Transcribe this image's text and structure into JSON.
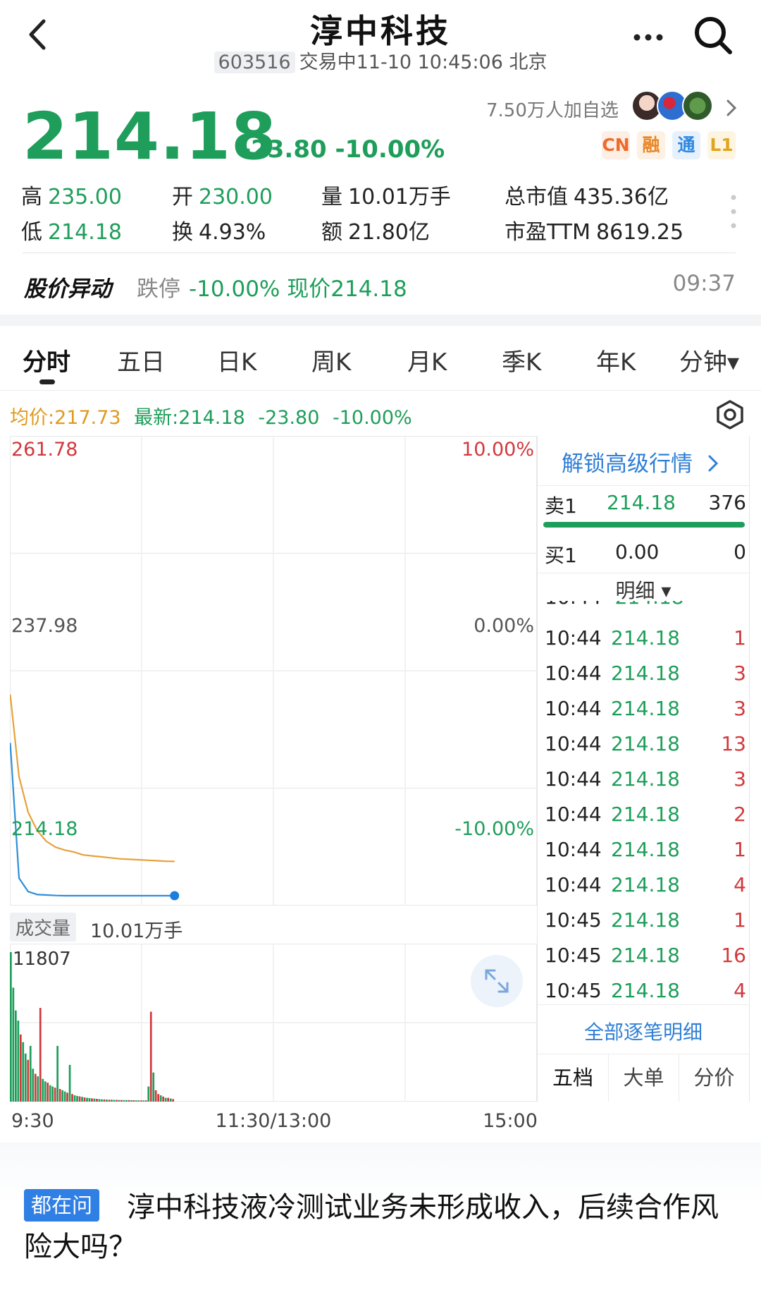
{
  "header": {
    "title": "淳中科技",
    "code": "603516",
    "status": "交易中11-10 10:45:06 北京"
  },
  "quote": {
    "price": "214.18",
    "change": "-23.80 -10.00%",
    "watchers": "7.50万人加自选",
    "tags": [
      {
        "label": "CN",
        "color": "#f06a2a",
        "bg": "#fdeee6"
      },
      {
        "label": "融",
        "color": "#e8872a",
        "bg": "#fdf1e3"
      },
      {
        "label": "通",
        "color": "#2f88e0",
        "bg": "#e6f1fd"
      },
      {
        "label": "L1",
        "color": "#e0a51f",
        "bg": "#fdf5e1"
      }
    ],
    "stats": [
      {
        "label": "高",
        "value": "235.00",
        "color": "green"
      },
      {
        "label": "开",
        "value": "230.00",
        "color": "green"
      },
      {
        "label": "量",
        "value": "10.01万手",
        "color": "plain"
      },
      {
        "label": "总市值",
        "value": "435.36亿",
        "color": "plain"
      },
      {
        "label": "低",
        "value": "214.18",
        "color": "green"
      },
      {
        "label": "换",
        "value": "4.93%",
        "color": "plain"
      },
      {
        "label": "额",
        "value": "21.80亿",
        "color": "plain"
      },
      {
        "label": "市盈TTM",
        "value": "8619.25",
        "color": "plain"
      }
    ]
  },
  "alert": {
    "label": "股价异动",
    "type": "跌停",
    "detail": "-10.00% 现价214.18",
    "time": "09:37"
  },
  "tabs": [
    "分时",
    "五日",
    "日K",
    "周K",
    "月K",
    "季K",
    "年K",
    "分钟▾"
  ],
  "chart_info": {
    "avg": "均价:217.73",
    "latest": "最新:214.18",
    "change": "-23.80",
    "pct": "-10.00%"
  },
  "chart_labels": {
    "y_top": "261.78",
    "y_mid": "237.98",
    "y_bottom": "214.18",
    "pct_top": "10.00%",
    "pct_mid": "0.00%",
    "pct_bottom": "-10.00%",
    "volume_tag": "成交量",
    "volume_total": "10.01万手",
    "volume_max": "11807",
    "x_labels": [
      "9:30",
      "11:30/13:00",
      "15:00"
    ]
  },
  "chart_data": {
    "type": "line",
    "ylim": [
      214.18,
      261.78
    ],
    "prev_close": 237.98,
    "series": [
      {
        "name": "均价",
        "color": "#e6a23c",
        "values": [
          235.0,
          226.5,
          222.8,
          220.9,
          219.8,
          219.2,
          218.9,
          218.7,
          218.4,
          218.3,
          218.2,
          218.1,
          218.0,
          217.95,
          217.9,
          217.85,
          217.8,
          217.75,
          217.73
        ]
      },
      {
        "name": "最新",
        "color": "#2f8ed8",
        "values": [
          230.0,
          216.0,
          214.6,
          214.3,
          214.25,
          214.2,
          214.18,
          214.18,
          214.18,
          214.18,
          214.18,
          214.18,
          214.18,
          214.18,
          214.18,
          214.18,
          214.18,
          214.18,
          214.18
        ]
      }
    ],
    "volume": {
      "max": 11807,
      "bars": [
        11807,
        9000,
        7200,
        6400,
        5300,
        4700,
        3800,
        3300,
        4400,
        2600,
        2200,
        2000,
        7400,
        1800,
        1600,
        1500,
        1300,
        1200,
        1100,
        4400,
        1000,
        900,
        800,
        700,
        2900,
        600,
        500,
        450,
        420,
        380,
        330,
        300,
        280,
        260,
        240,
        220,
        200,
        180,
        170,
        160,
        150,
        150,
        140,
        140,
        130,
        130,
        120,
        120,
        120,
        110,
        110,
        100,
        100,
        100,
        100,
        100,
        1200,
        7100,
        2300,
        900,
        600,
        500,
        400,
        300,
        300,
        250,
        200
      ],
      "colors": [
        "g",
        "g",
        "g",
        "g",
        "r",
        "g",
        "g",
        "r",
        "g",
        "g",
        "r",
        "g",
        "r",
        "g",
        "g",
        "r",
        "g",
        "g",
        "r",
        "g",
        "r",
        "g",
        "g",
        "r",
        "g",
        "r",
        "g",
        "g",
        "r",
        "g",
        "r",
        "g",
        "g",
        "r",
        "g",
        "r",
        "g",
        "g",
        "r",
        "g",
        "r",
        "g",
        "g",
        "r",
        "g",
        "r",
        "g",
        "g",
        "r",
        "g",
        "r",
        "g",
        "g",
        "r",
        "g",
        "r",
        "g",
        "r",
        "g",
        "r",
        "r",
        "g",
        "r",
        "g",
        "r",
        "g",
        "r"
      ]
    }
  },
  "order_book": {
    "unlock": "解锁高级行情",
    "sell1": {
      "label": "卖1",
      "price": "214.18",
      "qty": "376"
    },
    "buy1": {
      "label": "买1",
      "price": "0.00",
      "qty": "0"
    },
    "detail_title": "明细 ▾",
    "ticks": [
      {
        "time": "10:44",
        "price": "214.18",
        "vol": "1"
      },
      {
        "time": "10:44",
        "price": "214.18",
        "vol": "3"
      },
      {
        "time": "10:44",
        "price": "214.18",
        "vol": "3"
      },
      {
        "time": "10:44",
        "price": "214.18",
        "vol": "13"
      },
      {
        "time": "10:44",
        "price": "214.18",
        "vol": "3"
      },
      {
        "time": "10:44",
        "price": "214.18",
        "vol": "2"
      },
      {
        "time": "10:44",
        "price": "214.18",
        "vol": "1"
      },
      {
        "time": "10:44",
        "price": "214.18",
        "vol": "4"
      },
      {
        "time": "10:45",
        "price": "214.18",
        "vol": "1"
      },
      {
        "time": "10:45",
        "price": "214.18",
        "vol": "16"
      },
      {
        "time": "10:45",
        "price": "214.18",
        "vol": "4"
      }
    ],
    "all_detail": "全部逐笔明细",
    "bottom_tabs": [
      "五档",
      "大单",
      "分价"
    ]
  },
  "news": {
    "badge": "都在问",
    "text": "淳中科技液冷测试业务未形成收入，后续合作风险大吗？"
  }
}
